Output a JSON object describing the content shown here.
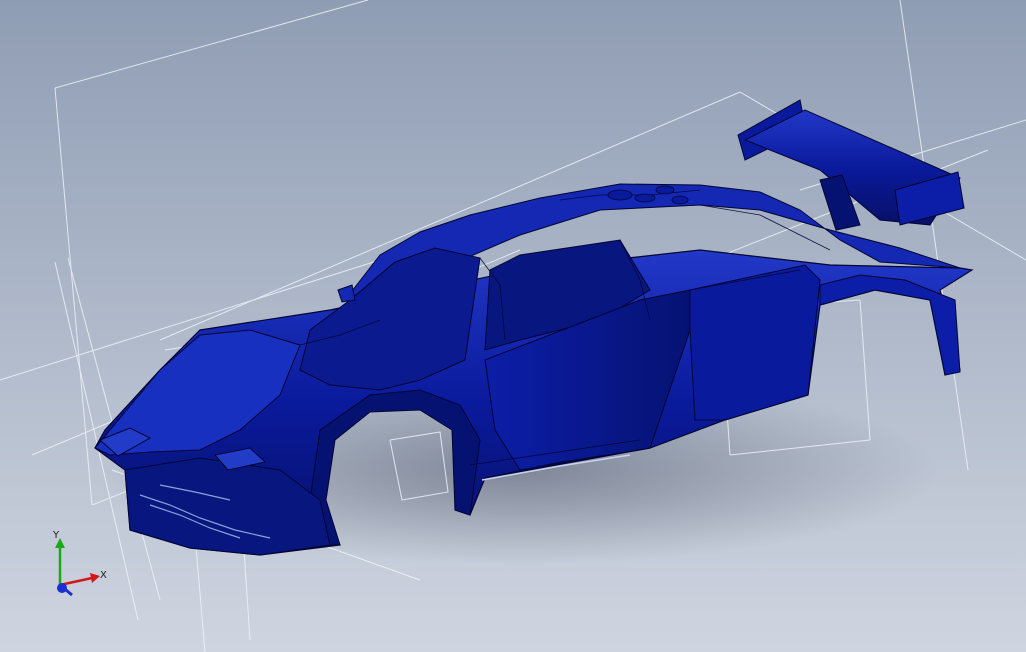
{
  "viewport": {
    "background_top": "#8f9db4",
    "background_bottom": "#cfd5e0"
  },
  "model": {
    "body_color": "#0a1a9c",
    "body_highlight": "#2238c8",
    "body_shadow": "#061066",
    "edge_color": "#000533"
  },
  "triad": {
    "x_label": "X",
    "y_label": "Y",
    "x_color": "#d01818",
    "y_color": "#18a818",
    "z_color": "#1830d0"
  }
}
